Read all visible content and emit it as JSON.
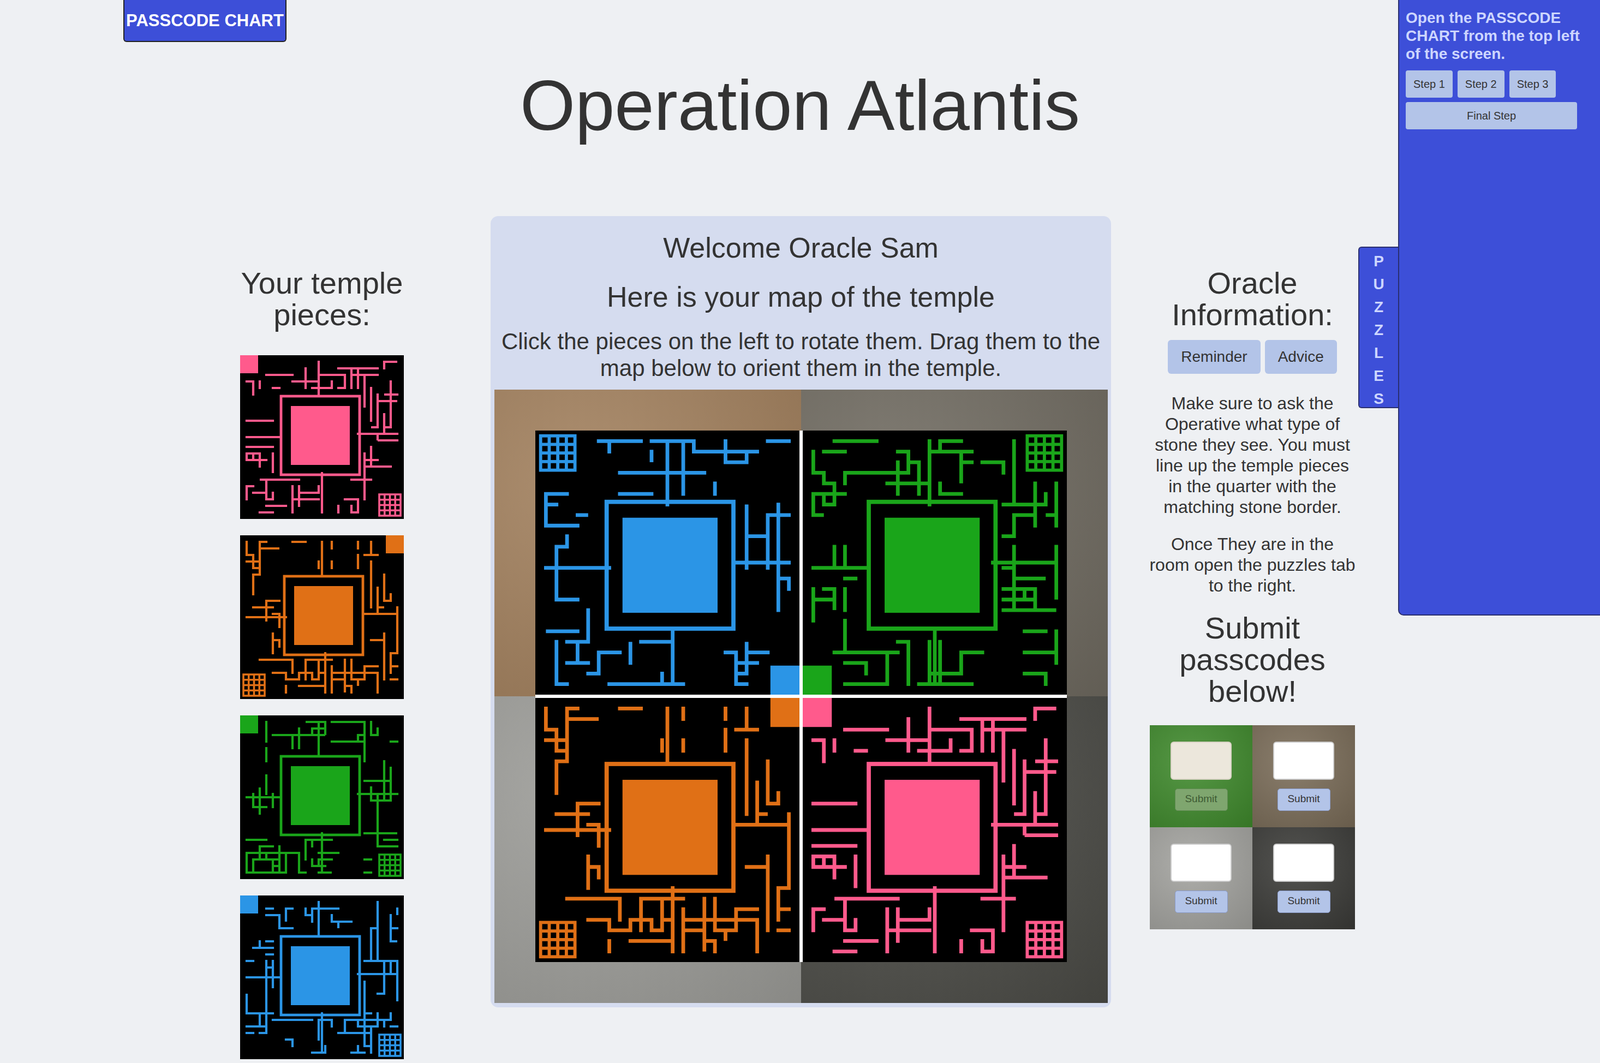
{
  "passcode_chart_button": "PASSCODE CHART",
  "title": "Operation Atlantis",
  "left": {
    "heading": "Your temple pieces:",
    "pieces": [
      {
        "color": "#ff5a8c",
        "rotation": 0
      },
      {
        "color": "#e07016",
        "rotation": 90
      },
      {
        "color": "#1aa51a",
        "rotation": 0
      },
      {
        "color": "#2b95e6",
        "rotation": 0
      }
    ]
  },
  "map_panel": {
    "welcome": "Welcome Oracle Sam",
    "subtitle": "Here is your map of the temple",
    "instructions": "Click the pieces on the left to rotate them. Drag them to the map below to orient them in the temple.",
    "quadrants": [
      {
        "stone_color": "#a17f5c",
        "color": "#2b95e6",
        "rotation": 180
      },
      {
        "stone_color": "#6f6a60",
        "color": "#1aa51a",
        "rotation": 270
      },
      {
        "stone_color": "#9c9c98",
        "color": "#e07016",
        "rotation": 90
      },
      {
        "stone_color": "#4b4b46",
        "color": "#ff5a8c",
        "rotation": 0
      }
    ]
  },
  "oracle": {
    "heading": "Oracle Information:",
    "tabs": [
      {
        "label": "Reminder",
        "selected": false
      },
      {
        "label": "Advice",
        "selected": false
      }
    ],
    "paragraphs": [
      "Make sure to ask the Operative what type of stone they see. You must line up the temple pieces in the quarter with the matching stone border.",
      "Once They are in the room open the puzzles tab to the right."
    ],
    "submit_heading": "Submit passcodes below!",
    "submit_boxes": [
      {
        "color": "#3f8a2c",
        "value": "",
        "button": "Submit",
        "disabled": true
      },
      {
        "color": "#7a6c58",
        "value": "",
        "button": "Submit",
        "disabled": false
      },
      {
        "color": "#a3a39f",
        "value": "",
        "button": "Submit",
        "disabled": false
      },
      {
        "color": "#3b3b38",
        "value": "",
        "button": "Submit",
        "disabled": false
      }
    ]
  },
  "puzzles_tab": "PUZZLES",
  "steps_panel": {
    "text": "Open the PASSCODE CHART from the top left of the screen.",
    "buttons": [
      "Step 1",
      "Step 2",
      "Step 3"
    ],
    "final_button": "Final Step"
  }
}
